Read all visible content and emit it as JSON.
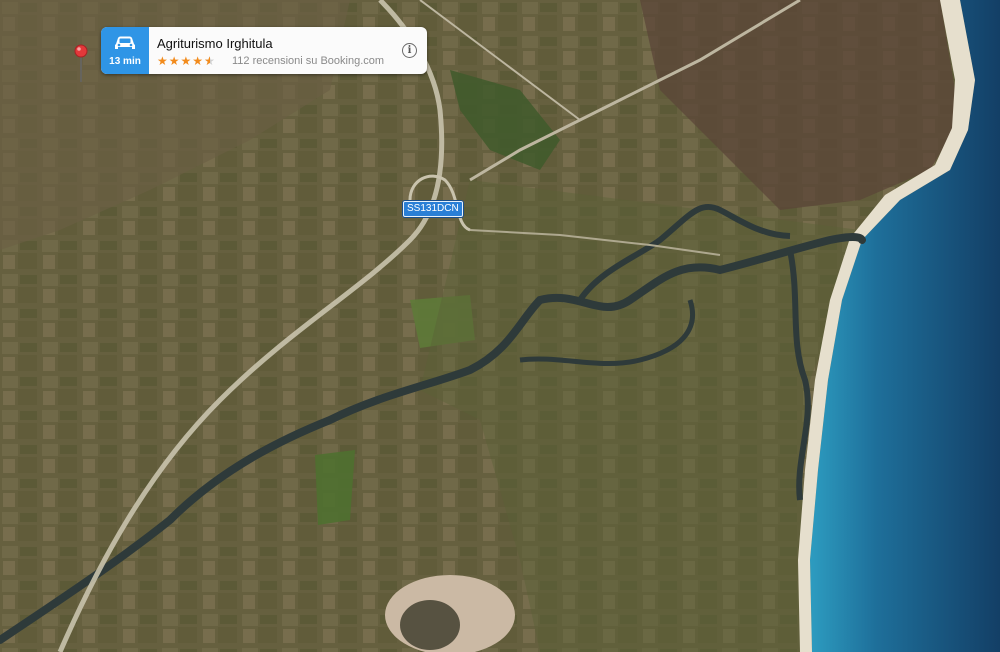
{
  "map": {
    "type": "satellite",
    "road_label": "SS131DCN"
  },
  "place": {
    "name": "Agriturismo Irghitula",
    "drive_time": "13 min",
    "rating": 4.5,
    "reviews_text": "112 recensioni su Booking.com",
    "transport_icon": "car-icon",
    "info_icon": "info-icon",
    "pin_icon": "map-pin-icon"
  },
  "colors": {
    "sea_deep": "#15456a",
    "sea_shallow": "#2d8fb5",
    "sand": "#e6dfcd",
    "river": "#2e3a3a",
    "drive_badge": "#2f95e6",
    "star": "#f28b1c",
    "road_shield": "#2a7fd6",
    "pin": "#e3383a"
  }
}
